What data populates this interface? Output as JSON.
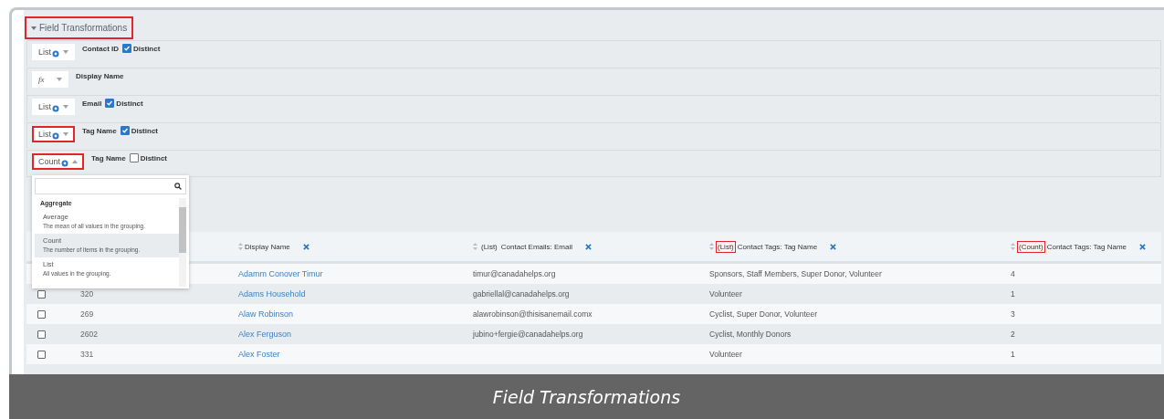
{
  "section": {
    "title": "Field Transformations",
    "expanded": true,
    "highlighted": true
  },
  "transforms": [
    {
      "kind": "list",
      "function": "List",
      "field": "Contact ID",
      "distinct": {
        "label": "Distinct",
        "checked": true
      },
      "highlighted": false
    },
    {
      "kind": "formula",
      "function": "fx",
      "field": "Display Name",
      "highlighted": false
    },
    {
      "kind": "list",
      "function": "List",
      "field": "Email",
      "distinct": {
        "label": "Distinct",
        "checked": true
      },
      "highlighted": false
    },
    {
      "kind": "list",
      "function": "List",
      "field": "Tag Name",
      "distinct": {
        "label": "Distinct",
        "checked": true
      },
      "highlighted": true
    },
    {
      "kind": "list",
      "function": "Count",
      "field": "Tag Name",
      "distinct": {
        "label": "Distinct",
        "checked": false
      },
      "highlighted": true,
      "expanded": true
    }
  ],
  "dropdown": {
    "group": "Aggregate",
    "options": [
      {
        "label": "Average",
        "description": "The mean of all values in the grouping.",
        "selected": false
      },
      {
        "label": "Count",
        "description": "The number of items in the grouping.",
        "selected": true
      },
      {
        "label": "List",
        "description": "All values in the grouping.",
        "selected": false
      }
    ]
  },
  "table": {
    "columns": [
      {
        "label": "Display Name"
      },
      {
        "prefix": "(List)",
        "label": "Contact Emails: Email"
      },
      {
        "prefix": "(List)",
        "label": "Contact Tags: Tag Name",
        "highlighted": true
      },
      {
        "prefix": "(Count)",
        "label": "Contact Tags: Tag Name",
        "highlighted": true
      }
    ],
    "rows": [
      {
        "cells": [
          "Adamm Conover Timur",
          "timur@canadahelps.org",
          "Sponsors, Staff Members, Super Donor, Volunteer",
          "4"
        ]
      },
      {
        "checked": false,
        "id": "320",
        "cells": [
          "Adams Household",
          "gabriellal@canadahelps.org",
          "Volunteer",
          "1"
        ]
      },
      {
        "checked": false,
        "id": "269",
        "cells": [
          "Alaw Robinson",
          "alawrobinson@thisisanemail.comx",
          "Cyclist, Super Donor, Volunteer",
          "3"
        ]
      },
      {
        "checked": false,
        "id": "2602",
        "cells": [
          "Alex Ferguson",
          "jubino+fergie@canadahelps.org",
          "Cyclist, Monthly Donors",
          "2"
        ]
      },
      {
        "checked": false,
        "id": "331",
        "cells": [
          "Alex Foster",
          "",
          "Volunteer",
          "1"
        ]
      }
    ]
  },
  "caption": "Field Transformations"
}
